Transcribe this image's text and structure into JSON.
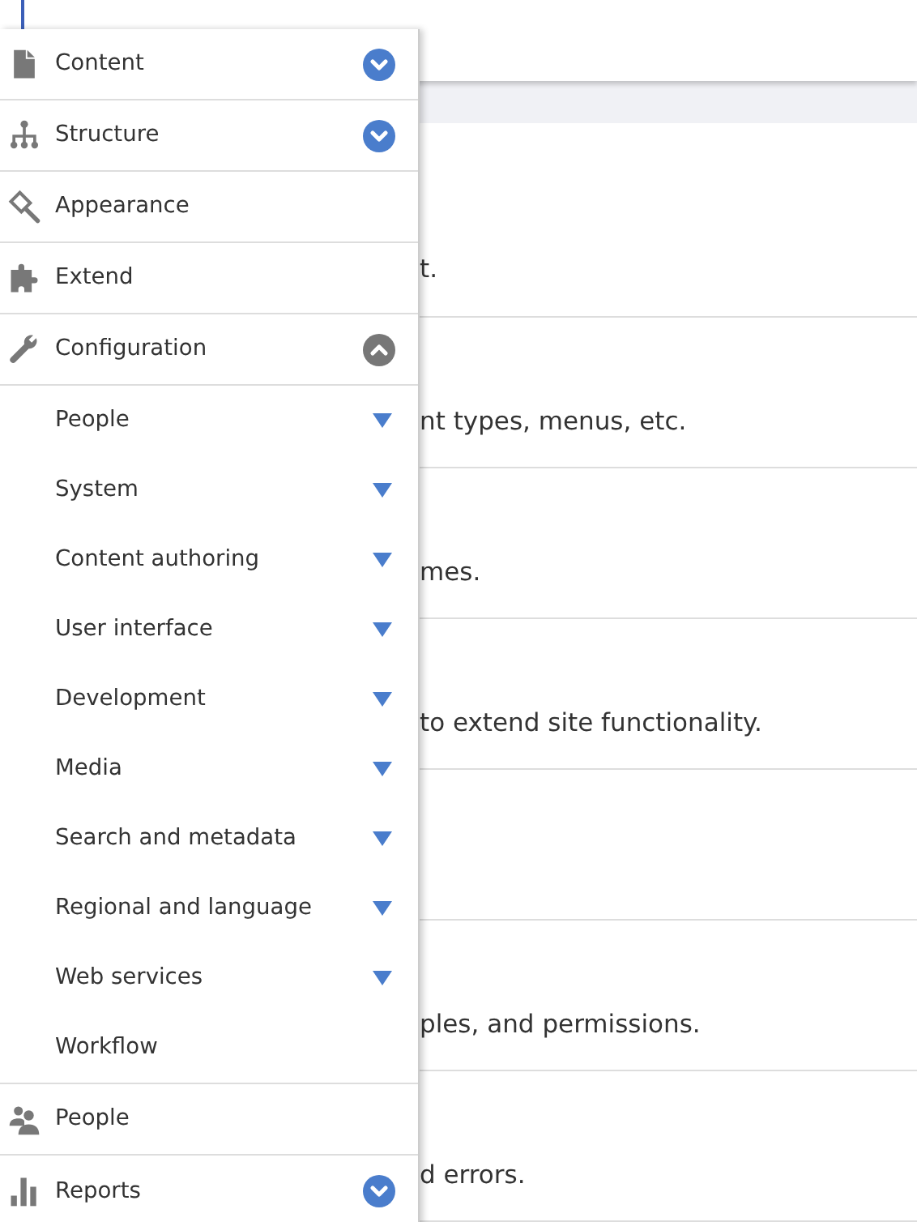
{
  "page_rows": [
    {
      "text": "t."
    },
    {
      "text": "nt types, menus, etc."
    },
    {
      "text": "mes."
    },
    {
      "text": "to extend site functionality."
    },
    {},
    {
      "text": "ples, and permissions."
    },
    {
      "text": "d errors."
    }
  ],
  "menu": {
    "items": [
      {
        "label": "Content",
        "expanded": false
      },
      {
        "label": "Structure",
        "expanded": false
      },
      {
        "label": "Appearance"
      },
      {
        "label": "Extend"
      },
      {
        "label": "Configuration",
        "expanded": true,
        "children": [
          {
            "label": "People",
            "expandable": true
          },
          {
            "label": "System",
            "expandable": true
          },
          {
            "label": "Content authoring",
            "expandable": true
          },
          {
            "label": "User interface",
            "expandable": true
          },
          {
            "label": "Development",
            "expandable": true
          },
          {
            "label": "Media",
            "expandable": true
          },
          {
            "label": "Search and metadata",
            "expandable": true
          },
          {
            "label": "Regional and language",
            "expandable": true
          },
          {
            "label": "Web services",
            "expandable": true
          },
          {
            "label": "Workflow",
            "expandable": false
          }
        ]
      },
      {
        "label": "People"
      },
      {
        "label": "Reports",
        "expanded": false
      }
    ]
  }
}
